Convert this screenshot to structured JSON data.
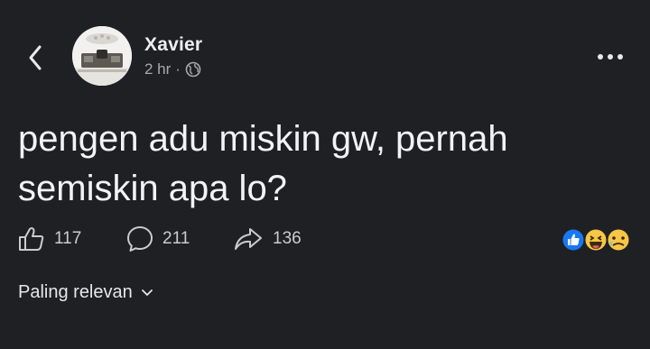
{
  "header": {
    "back_icon": "chevron-left-icon",
    "author_name": "Xavier",
    "time": "2 hr",
    "separator": "·",
    "privacy_icon": "globe-icon",
    "more_icon": "more-horizontal-icon"
  },
  "post": {
    "text": "pengen adu miskin gw, pernah\nsemiskin apa lo?"
  },
  "actions": {
    "like": {
      "icon": "thumbs-up-icon",
      "count": "117"
    },
    "comment": {
      "icon": "comment-bubble-icon",
      "count": "211"
    },
    "share": {
      "icon": "share-arrow-icon",
      "count": "136"
    }
  },
  "reactions": [
    "like",
    "haha",
    "sad"
  ],
  "sort": {
    "label": "Paling relevan",
    "icon": "chevron-down-icon"
  },
  "colors": {
    "background": "#1f2024",
    "text": "#f2f3f5",
    "muted": "#a6a9b0",
    "like_blue": "#1877f2",
    "emoji_yellow": "#f7c646"
  }
}
